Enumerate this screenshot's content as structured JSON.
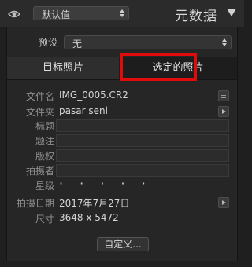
{
  "header": {
    "preset_value": "默认值",
    "panel_title": "元数据"
  },
  "preset": {
    "label": "预设",
    "value": "无"
  },
  "tabs": [
    {
      "label": "目标照片"
    },
    {
      "label": "选定的照片"
    }
  ],
  "fields": {
    "filename": {
      "label": "文件名",
      "value": "IMG_0005.CR2"
    },
    "folder": {
      "label": "文件夹",
      "value": "pasar seni"
    },
    "title": {
      "label": "标题"
    },
    "caption": {
      "label": "题注"
    },
    "copyright": {
      "label": "版权"
    },
    "creator": {
      "label": "拍摄者"
    },
    "rating": {
      "label": "星级",
      "value": "· · · · ·"
    },
    "capture_date": {
      "label": "拍摄日期",
      "value": "2017年7月27日"
    },
    "dimensions": {
      "label": "尺寸",
      "value": "3648 x 5472"
    }
  },
  "customize_button": "自定义..."
}
